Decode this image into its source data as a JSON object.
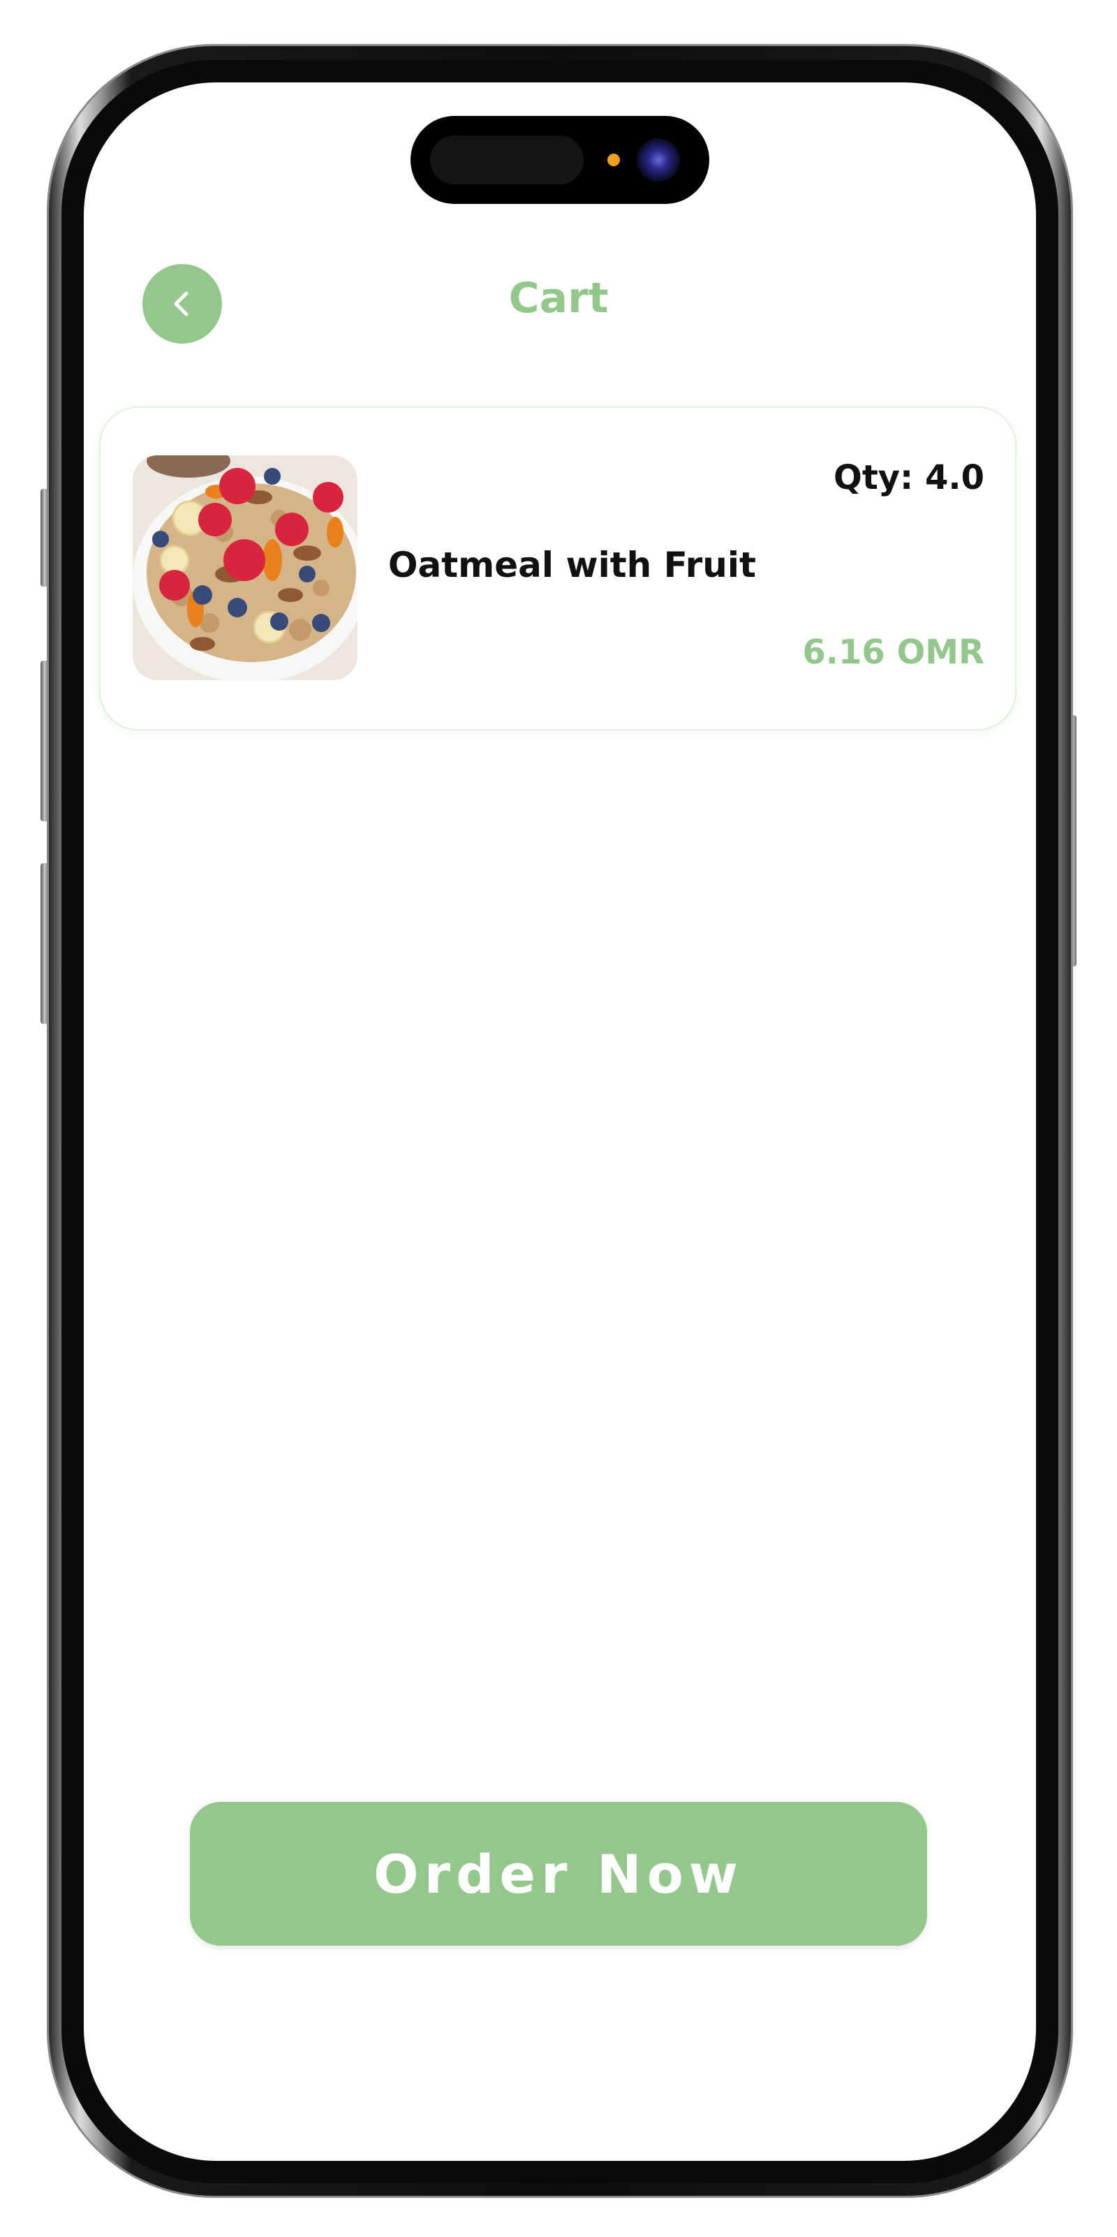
{
  "header": {
    "title": "Cart",
    "back_icon": "chevron-left-icon"
  },
  "cart": {
    "items": [
      {
        "name": "Oatmeal with Fruit",
        "quantity": "Qty: 4.0",
        "price": "6.16 OMR",
        "image": "oatmeal-with-fruit-photo"
      }
    ]
  },
  "footer": {
    "order_button_label": "Order Now"
  },
  "colors": {
    "accent": "#94c78b",
    "text": "#111111",
    "background": "#ffffff"
  }
}
